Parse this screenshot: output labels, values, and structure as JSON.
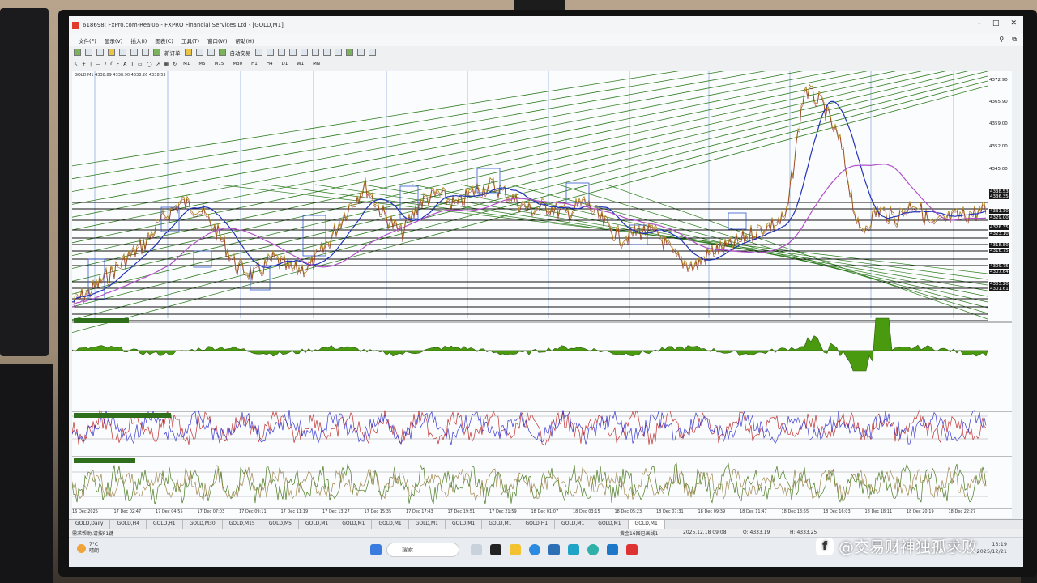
{
  "window": {
    "title": "618698: FxPro.com-Real06 - FXPRO Financial Services Ltd - [GOLD,M1]"
  },
  "menu": [
    "文件(F)",
    "显示(V)",
    "插入(I)",
    "图表(C)",
    "工具(T)",
    "窗口(W)",
    "帮助(H)"
  ],
  "toolbar": {
    "new_order": "新订单",
    "auto_trade": "自动交易",
    "timeframes": [
      "M1",
      "M5",
      "M15",
      "M30",
      "H1",
      "H4",
      "D1",
      "W1",
      "MN"
    ]
  },
  "chart": {
    "ohlc_label": "GOLD,M1 4338.89 4338.90 4338.26 4338.53",
    "price_ticks": [
      "4372.90",
      "4365.90",
      "4359.00",
      "4352.00",
      "4345.00",
      "4338.53",
      "4336.35",
      "4331.30",
      "4329.00",
      "4326.35",
      "4323.10",
      "4318.80",
      "4316.75",
      "4309.75",
      "4307.64",
      "4303.20",
      "4301.61"
    ],
    "time_ticks": [
      "16 Dec 2025",
      "17 Dec 02:47",
      "17 Dec 04:55",
      "17 Dec 07:03",
      "17 Dec 09:11",
      "17 Dec 11:19",
      "17 Dec 13:27",
      "17 Dec 15:35",
      "17 Dec 17:43",
      "17 Dec 19:51",
      "17 Dec 21:59",
      "18 Dec 01:07",
      "18 Dec 03:15",
      "18 Dec 05:23",
      "18 Dec 07:31",
      "18 Dec 09:39",
      "18 Dec 11:47",
      "18 Dec 13:55",
      "18 Dec 16:03",
      "18 Dec 18:11",
      "18 Dec 20:19",
      "18 Dec 22:27"
    ]
  },
  "tabs": [
    "GOLD,Daily",
    "GOLD,H4",
    "GOLD,H1",
    "GOLD,M30",
    "GOLD,M15",
    "GOLD,M5",
    "GOLD,M1",
    "GOLD,M1",
    "GOLD,M1",
    "GOLD,M1",
    "GOLD,M1",
    "GOLD,M1",
    "GOLD,H1",
    "GOLD,M1",
    "GOLD,M1",
    "GOLD,M1"
  ],
  "status": {
    "help": "需求帮助,请按F1键",
    "profile": "黄金16图已画线1",
    "datetime": "2025.12.18 09:08",
    "open": "O: 4333.19",
    "high": "H: 4333.25"
  },
  "taskbar": {
    "temperature": "7°C",
    "weather": "晴朗",
    "search_placeholder": "搜索",
    "time": "13:19",
    "date": "2025/12/21"
  },
  "watermark": "@交易财神独孤求败",
  "colors": {
    "ma_blue": "#2233bb",
    "ma_magenta": "#b050c8",
    "osc_green": "#4a9a10",
    "trend_green": "#2e7d1f"
  }
}
